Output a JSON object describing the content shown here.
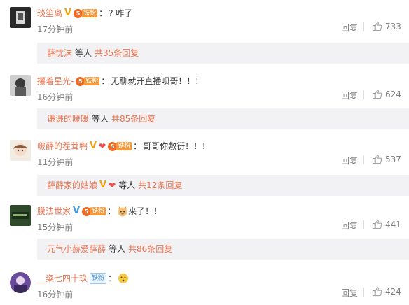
{
  "comments": [
    {
      "username": "琰笙离",
      "verified": "gold",
      "fan_level": "5",
      "fan_label": "铁粉",
      "text": "? 咋了",
      "time": "17分钟前",
      "reply_label": "回复",
      "likes": "733",
      "reply_preview": {
        "user": "薛忧沫",
        "middle": "等人",
        "count": "共35条回复"
      }
    },
    {
      "username": "攥着星光-",
      "verified": "",
      "fan_level": "5",
      "fan_label": "铁粉",
      "text": "无聊就开直播呗哥！！！",
      "time": "16分钟前",
      "reply_label": "回复",
      "likes": "624",
      "reply_preview": {
        "user": "谦谦的暖暖",
        "middle": "等人",
        "count": "共85条回复"
      }
    },
    {
      "username": "啵薛的茬茸鸭",
      "verified": "gold",
      "fan_level": "5",
      "fan_label": "铁粉",
      "text": "哥哥你敷衍！！！",
      "time": "11分钟前",
      "reply_label": "回复",
      "likes": "537",
      "reply_preview": {
        "user": "薛薛家的姑娘",
        "middle": "等人",
        "count": "共12条回复"
      }
    },
    {
      "username": "膜法世家",
      "verified": "blue",
      "fan_level": "5",
      "fan_label": "铁粉",
      "text": "来了！！",
      "time": "15分钟前",
      "reply_label": "回复",
      "likes": "441",
      "reply_preview": {
        "user": "元气小赫爱薛薛",
        "middle": "等人",
        "count": "共86条回复"
      }
    },
    {
      "username": "__粢七四十玖",
      "verified": "",
      "fan_level": "",
      "fan_label": "铁粉",
      "text": "",
      "time": "16分钟前",
      "reply_label": "回复",
      "likes": "424"
    }
  ],
  "verified_glyph": "V",
  "colon": "：",
  "colors": {
    "username": "#eb7350",
    "time": "#808080",
    "reply_bg": "#f2f2f5"
  }
}
